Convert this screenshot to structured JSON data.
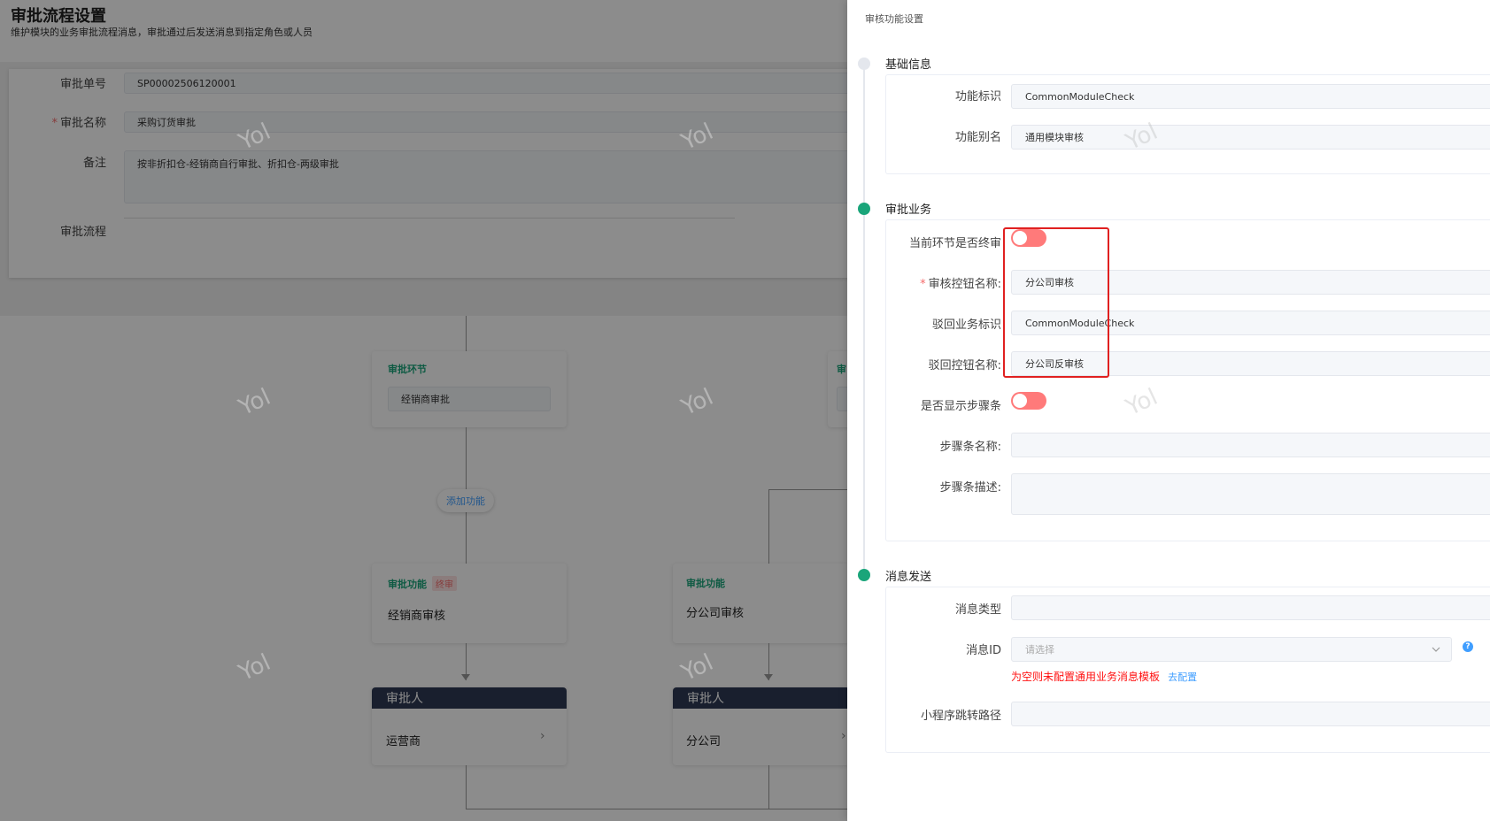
{
  "page": {
    "title": "审批流程设置",
    "subtitle": "维护模块的业务审批流程消息，审批通过后发送消息到指定角色或人员"
  },
  "form": {
    "approval_no_label": "审批单号",
    "approval_no_value": "SP00002506120001",
    "approval_name_label": "审批名称",
    "approval_name_value": "采购订货审批",
    "remark_label": "备注",
    "remark_value": "按非折扣仓-经销商自行审批、折扣仓-两级审批",
    "flow_label": "审批流程"
  },
  "flow": {
    "step_tag": "审批环节",
    "step_value": "经销商审批",
    "step2_tag_partial": "审",
    "add_function": "添加功能",
    "func_tag": "审批功能",
    "final_badge": "终审",
    "func1_title": "经销商审核",
    "func2_title": "分公司审核",
    "approver_label": "审批人",
    "approver1": "运营商",
    "approver2": "分公司",
    "chevron": "›"
  },
  "watermark": "Yol",
  "drawer": {
    "title": "审核功能设置",
    "basic": {
      "title": "基础信息",
      "func_id_label": "功能标识",
      "func_id_value": "CommonModuleCheck",
      "func_alias_label": "功能别名",
      "func_alias_value": "通用模块审核"
    },
    "business": {
      "title": "审批业务",
      "is_final_label": "当前环节是否终审",
      "is_final_on": false,
      "audit_btn_label": "审核控钮名称:",
      "audit_btn_value": "分公司审核",
      "reject_id_label": "驳回业务标识",
      "reject_id_value": "CommonModuleCheck",
      "reject_btn_label": "驳回控钮名称:",
      "reject_btn_value": "分公司反审核",
      "show_steps_label": "是否显示步骤条",
      "show_steps_on": false,
      "step_name_label": "步骤条名称:",
      "step_name_value": "",
      "step_desc_label": "步骤条描述:",
      "step_desc_value": ""
    },
    "message": {
      "title": "消息发送",
      "type_label": "消息类型",
      "type_value": "",
      "id_label": "消息ID",
      "id_placeholder": "请选择",
      "help": "?",
      "warn": "为空则未配置通用业务消息模板",
      "config_link": "去配置",
      "path_label": "小程序跳转路径",
      "path_value": ""
    }
  },
  "colors": {
    "accent_green": "#1aa57a",
    "switch_off": "#ff7a7a",
    "highlight_frame": "#e02020",
    "link_blue": "#409eff",
    "approver_header": "#2f3a54"
  }
}
